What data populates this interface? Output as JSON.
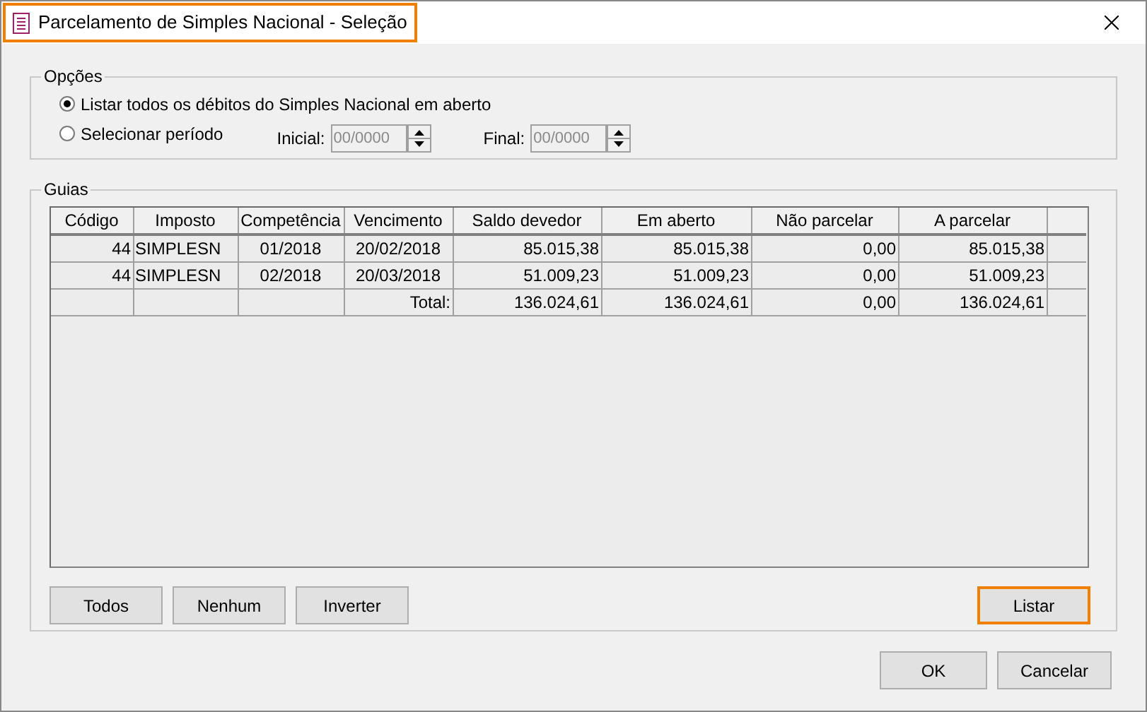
{
  "window": {
    "title": "Parcelamento de Simples Nacional - Seleção",
    "highlighted": true
  },
  "options": {
    "legend": "Opções",
    "radios": [
      {
        "label": "Listar todos os débitos do Simples Nacional em aberto",
        "selected": true
      },
      {
        "label": "Selecionar período",
        "selected": false
      }
    ],
    "initial": {
      "label": "Inicial:",
      "value": "00/0000",
      "disabled": true
    },
    "final": {
      "label": "Final:",
      "value": "00/0000",
      "disabled": true
    }
  },
  "guias": {
    "legend": "Guias",
    "columns": [
      "Código",
      "Imposto",
      "Competência",
      "Vencimento",
      "Saldo devedor",
      "Em aberto",
      "Não parcelar",
      "A parcelar"
    ],
    "rows": [
      [
        "44",
        "SIMPLESN",
        "01/2018",
        "20/02/2018",
        "85.015,38",
        "85.015,38",
        "0,00",
        "85.015,38"
      ],
      [
        "44",
        "SIMPLESN",
        "02/2018",
        "20/03/2018",
        "51.009,23",
        "51.009,23",
        "0,00",
        "51.009,23"
      ],
      [
        "",
        "",
        "",
        "Total:",
        "136.024,61",
        "136.024,61",
        "0,00",
        "136.024,61"
      ]
    ],
    "buttons": [
      {
        "label": "Todos",
        "highlighted": false
      },
      {
        "label": "Nenhum",
        "highlighted": false
      },
      {
        "label": "Inverter",
        "highlighted": false
      }
    ],
    "list_button": {
      "label": "Listar",
      "highlighted": true
    }
  },
  "buttons": [
    "OK",
    "Cancelar"
  ]
}
